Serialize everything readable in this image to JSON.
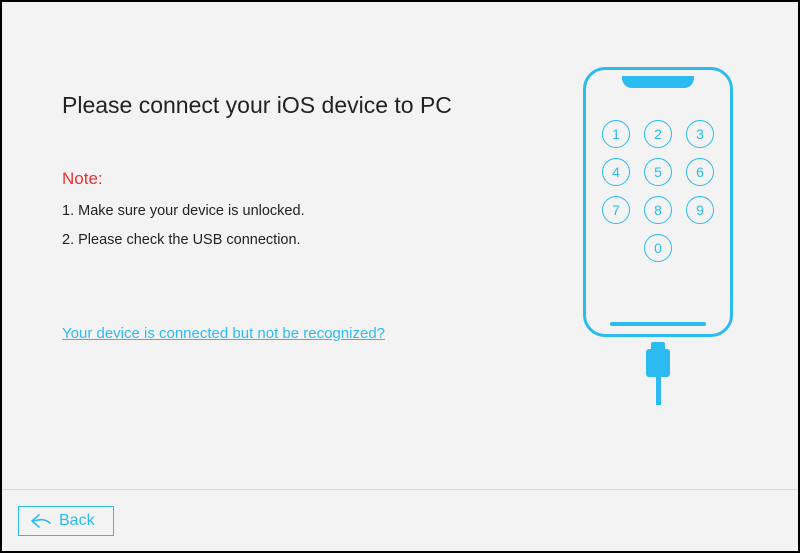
{
  "title": "Please connect your iOS device to PC",
  "note_label": "Note:",
  "notes": {
    "n1": "1. Make sure your device is unlocked.",
    "n2": "2. Please check the USB connection."
  },
  "help_link": "Your device is connected but not be recognized?",
  "keypad": {
    "k1": "1",
    "k2": "2",
    "k3": "3",
    "k4": "4",
    "k5": "5",
    "k6": "6",
    "k7": "7",
    "k8": "8",
    "k9": "9",
    "k0": "0"
  },
  "footer": {
    "back_label": "Back"
  }
}
